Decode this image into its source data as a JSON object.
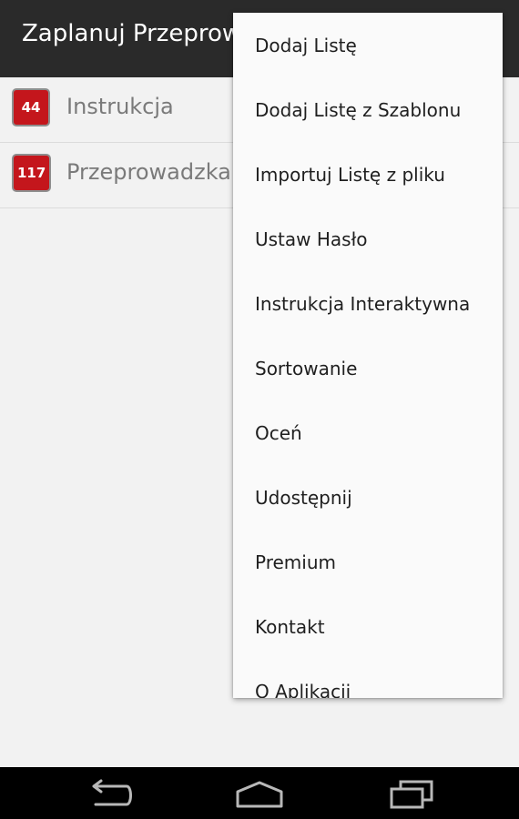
{
  "action_bar": {
    "title": "Zaplanuj Przeprowadzkę"
  },
  "lists": [
    {
      "count": "44",
      "name": "Instrukcja"
    },
    {
      "count": "117",
      "name": "Przeprowadzka"
    }
  ],
  "menu": {
    "items": [
      "Dodaj Listę",
      "Dodaj Listę z Szablonu",
      "Importuj Listę z pliku",
      "Ustaw Hasło",
      "Instrukcja Interaktywna",
      "Sortowanie",
      "Oceń",
      "Udostępnij",
      "Premium",
      "Kontakt",
      "O Aplikacji"
    ]
  },
  "nav": {
    "icons": [
      "back-icon",
      "home-icon",
      "recent-apps-icon"
    ]
  },
  "colors": {
    "action_bar": "#2a2a2a",
    "badge": "#c4161c",
    "background": "#f2f2f2",
    "menu": "#fafafa",
    "nav_bar": "#000000"
  }
}
